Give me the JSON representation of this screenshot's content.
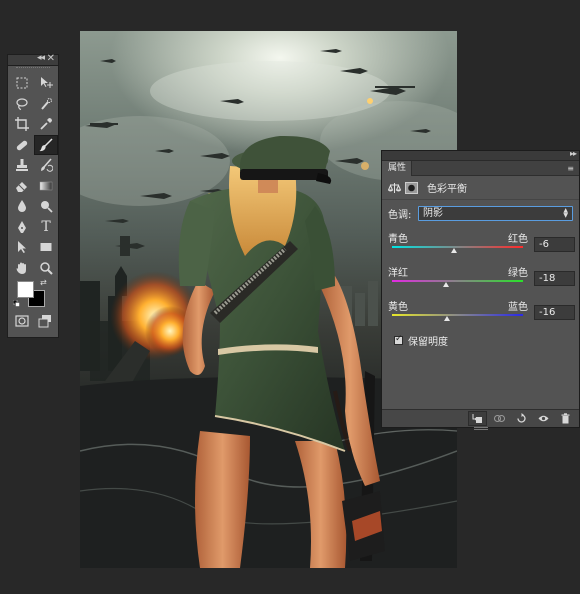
{
  "tools_panel": {
    "collapse_glyph": "◂◂",
    "close_glyph": "✕",
    "tools": [
      "marquee-icon",
      "move-icon",
      "lasso-icon",
      "quick-select-icon",
      "crop-icon",
      "eyedropper-icon",
      "healing-brush-icon",
      "brush-icon",
      "clone-stamp-icon",
      "history-brush-icon",
      "eraser-icon",
      "gradient-icon",
      "blur-icon",
      "dodge-icon",
      "pen-icon",
      "type-icon",
      "path-select-icon",
      "rectangle-icon",
      "hand-icon",
      "zoom-icon"
    ],
    "active_tool": "brush-icon",
    "type_glyph": "T",
    "foreground_color": "#ffffff",
    "background_color": "#000000",
    "swap_glyph": "⇄"
  },
  "properties_panel": {
    "tab_label": "属性",
    "menu_glyph": "≡",
    "collapse_glyph": "▸▸",
    "adjustment_title": "色彩平衡",
    "tone_label": "色调:",
    "tone_value": "阴影",
    "sliders": [
      {
        "left": "青色",
        "right": "红色",
        "value": "-6",
        "position": -6,
        "gradient": [
          "#00e5e5",
          "#ff2a2a"
        ]
      },
      {
        "left": "洋红",
        "right": "绿色",
        "value": "-18",
        "position": -18,
        "gradient": [
          "#e12ae1",
          "#2ae12a"
        ]
      },
      {
        "left": "黄色",
        "right": "蓝色",
        "value": "-16",
        "position": -16,
        "gradient": [
          "#e8e82a",
          "#2a2ae8"
        ]
      }
    ],
    "slider_range": [
      -100,
      100
    ],
    "preserve_label": "保留明度",
    "preserve_checked": true,
    "footer_icons": [
      "clip-to-layer-icon",
      "view-previous-icon",
      "reset-icon",
      "visibility-icon",
      "delete-icon"
    ]
  }
}
